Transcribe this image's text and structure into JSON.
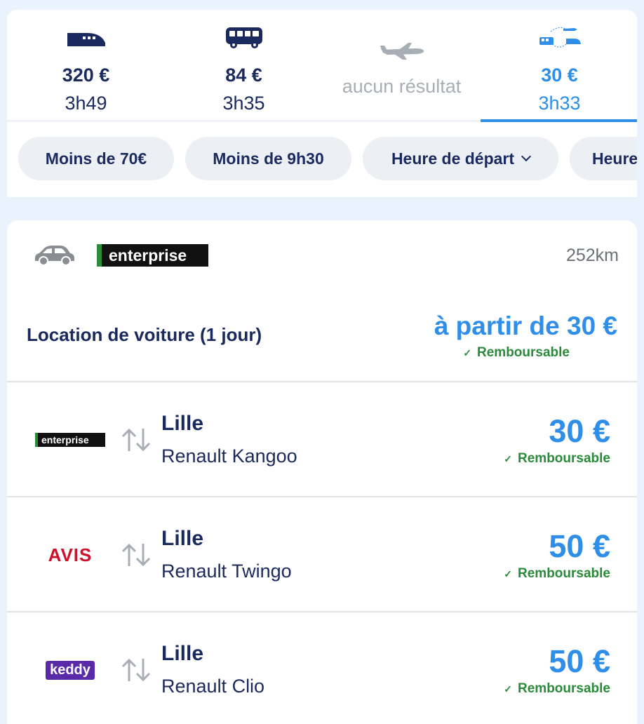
{
  "modes": [
    {
      "icon": "train-icon",
      "price": "320 €",
      "duration": "3h49",
      "active": false
    },
    {
      "icon": "bus-icon",
      "price": "84 €",
      "duration": "3h35",
      "active": false
    },
    {
      "icon": "plane-icon",
      "empty_text": "aucun résultat",
      "active": false
    },
    {
      "icon": "multimodal-icon",
      "price": "30 €",
      "duration": "3h33",
      "active": true
    }
  ],
  "filters": [
    "Moins de 70€",
    "Moins de 9h30",
    "Heure de départ",
    "Heure"
  ],
  "summary": {
    "vehicle_icon": "car-icon",
    "provider": "enterprise",
    "distance": "252km",
    "title": "Location de voiture (1 jour)",
    "price": "à partir de 30 €",
    "refund": "Remboursable",
    "check": "✓"
  },
  "offers": [
    {
      "provider": "enterprise",
      "city": "Lille",
      "car": "Renault Kangoo",
      "price": "30 €",
      "refund": "Remboursable",
      "check": "✓"
    },
    {
      "provider": "AVIS",
      "city": "Lille",
      "car": "Renault Twingo",
      "price": "50 €",
      "refund": "Remboursable",
      "check": "✓"
    },
    {
      "provider": "keddy",
      "city": "Lille",
      "car": "Renault Clio",
      "price": "50 €",
      "refund": "Remboursable",
      "check": "✓"
    }
  ],
  "colors": {
    "accent": "#2e8ee8",
    "navy": "#1a2a5e",
    "refund_green": "#2a8a3a",
    "enterprise_green": "#2e8b3a",
    "avis_red": "#d0102a",
    "keddy_purple": "#5a2aa8"
  }
}
